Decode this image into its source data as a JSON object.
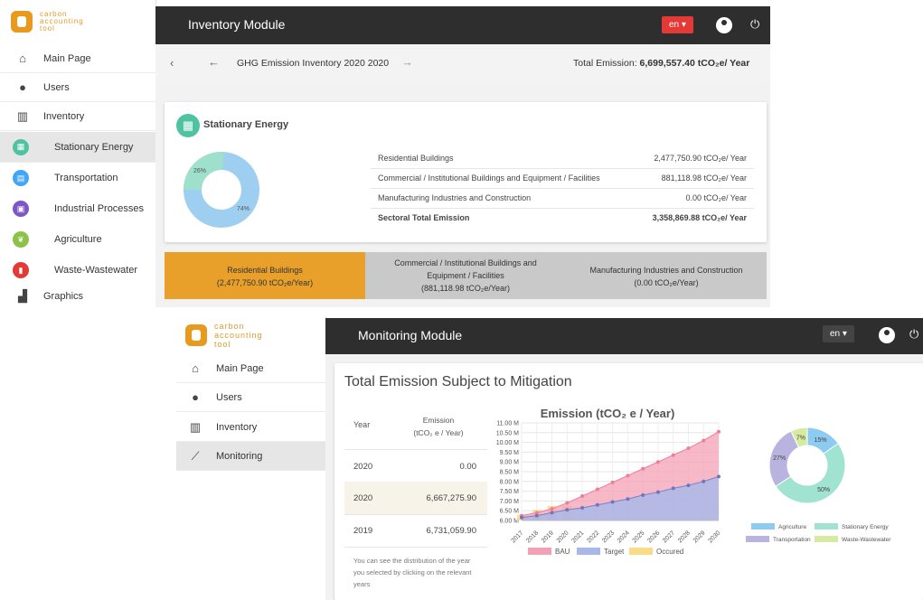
{
  "inventory_screen": {
    "logo_text": "carbon\naccounting\ntool",
    "header": {
      "title": "Inventory Module",
      "lang": "en"
    },
    "breadcrumb": {
      "title": "GHG Emission Inventory 2020 2020",
      "total_label": "Total Emission:",
      "total_value": "6,699,557.40 tCO₂e/ Year"
    },
    "sidebar": [
      {
        "label": "Main Page",
        "icon": "home-icon"
      },
      {
        "label": "Users",
        "icon": "user-icon"
      },
      {
        "label": "Inventory",
        "icon": "building-icon"
      },
      {
        "label": "Stationary Energy",
        "icon": "building-icon",
        "color": "#4fc3a1"
      },
      {
        "label": "Transportation",
        "icon": "bus-icon",
        "color": "#42a5f5"
      },
      {
        "label": "Industrial Processes",
        "icon": "factory-icon",
        "color": "#7e57c2"
      },
      {
        "label": "Agriculture",
        "icon": "leaf-icon",
        "color": "#8bc34a"
      },
      {
        "label": "Waste-Wastewater",
        "icon": "trash-icon",
        "color": "#e53935"
      },
      {
        "label": "Graphics",
        "icon": "bar-chart-icon"
      }
    ],
    "sector": {
      "title": "Stationary Energy",
      "rows": [
        {
          "label": "Residential Buildings",
          "value": "2,477,750.90 tCO₂e/ Year"
        },
        {
          "label": "Commercial / Institutional Buildings and Equipment / Facilities",
          "value": "881,118.98 tCO₂e/ Year"
        },
        {
          "label": "Manufacturing Industries and Construction",
          "value": "0.00 tCO₂e/ Year"
        },
        {
          "label": "Sectoral Total Emission",
          "value": "3,358,869.88 tCO₂e/ Year"
        }
      ],
      "donut": [
        {
          "label": "26%",
          "value": 26,
          "color": "#9fe0cc"
        },
        {
          "label": "74%",
          "value": 74,
          "color": "#9ecff0"
        }
      ]
    },
    "tabs": [
      {
        "line1": "Residential Buildings",
        "line2": "(2,477,750.90 tCO₂e/Year)",
        "color": "#e8a02a"
      },
      {
        "line1": "Commercial / Institutional Buildings and",
        "line2": "Equipment / Facilities",
        "line3": "(881,118.98 tCO₂e/Year)",
        "color": "#c9c9c9"
      },
      {
        "line1": "Manufacturing Industries and Construction",
        "line2": "(0.00 tCO₂e/Year)",
        "color": "#c9c9c9"
      }
    ]
  },
  "monitoring_screen": {
    "logo_text": "carbon\naccounting\ntool",
    "header": {
      "title": "Monitoring Module",
      "lang": "en"
    },
    "sidebar": [
      {
        "label": "Main Page",
        "icon": "home-icon"
      },
      {
        "label": "Users",
        "icon": "user-icon"
      },
      {
        "label": "Inventory",
        "icon": "building-icon"
      },
      {
        "label": "Monitoring",
        "icon": "trend-icon"
      }
    ],
    "page_title": "Total Emission Subject to Mitigation",
    "table": {
      "col_year": "Year",
      "col_emission_1": "Emission",
      "col_emission_2": "(tCO₂ e / Year)",
      "rows": [
        {
          "year": "2020",
          "value": "0.00"
        },
        {
          "year": "2020",
          "value": "6,667,275.90"
        },
        {
          "year": "2019",
          "value": "6,731,059.90"
        }
      ],
      "note": "You can see the distribution of the year you selected by clicking on the relevant years"
    }
  },
  "chart_data": [
    {
      "type": "area",
      "title": "Emission (tCO₂ e / Year)",
      "categories": [
        "2017",
        "2018",
        "2019",
        "2020",
        "2021",
        "2022",
        "2023",
        "2024",
        "2025",
        "2026",
        "2027",
        "2028",
        "2029",
        "2030"
      ],
      "y_ticks": [
        "11.00 M",
        "10.50 M",
        "10.00 M",
        "9.50 M",
        "9.00 M",
        "8.50 M",
        "8.00 M",
        "7.50 M",
        "7.00 M",
        "6.50 M",
        "6.00 M"
      ],
      "ylim": [
        6.0,
        11.0
      ],
      "series": [
        {
          "name": "BAU",
          "color": "#f4a0b4",
          "values": [
            6.25,
            6.4,
            6.6,
            6.9,
            7.25,
            7.6,
            7.95,
            8.3,
            8.65,
            9.0,
            9.35,
            9.7,
            10.1,
            10.55
          ]
        },
        {
          "name": "Target",
          "color": "#a9b8e8",
          "values": [
            6.15,
            6.25,
            6.4,
            6.55,
            6.65,
            6.8,
            6.95,
            7.1,
            7.3,
            7.45,
            7.65,
            7.8,
            8.0,
            8.25
          ]
        },
        {
          "name": "Occured",
          "color": "#f8dc8a",
          "values": [
            6.3,
            6.55,
            6.75,
            6.75,
            null,
            null,
            null,
            null,
            null,
            null,
            null,
            null,
            null,
            null
          ]
        }
      ]
    },
    {
      "type": "pie",
      "slices": [
        {
          "name": "Agriculture",
          "value": 15,
          "label": "15%",
          "color": "#8ecbf0"
        },
        {
          "name": "Stationary Energy",
          "value": 50,
          "label": "50%",
          "color": "#9fe3d0"
        },
        {
          "name": "Transportation",
          "value": 27,
          "label": "27%",
          "color": "#b9b4df"
        },
        {
          "name": "Waste-Wastewater",
          "value": 7,
          "label": "7%",
          "color": "#d6eba0"
        }
      ]
    }
  ]
}
